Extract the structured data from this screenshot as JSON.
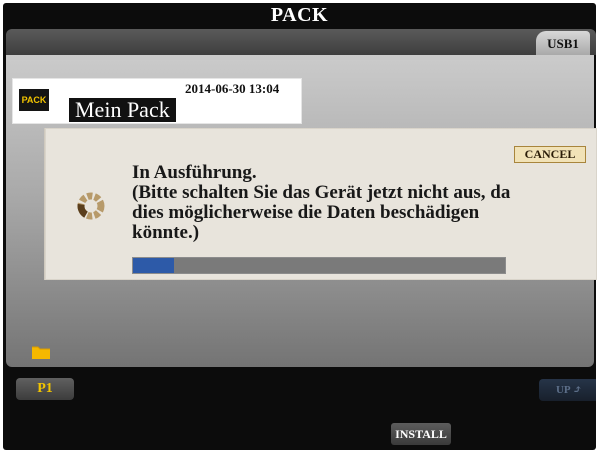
{
  "screen_title": "PACK",
  "tabs": {
    "device": "USB1"
  },
  "pack": {
    "logo_text": "PACK",
    "date": "2014-06-30 13:04",
    "name": "Mein Pack"
  },
  "dialog": {
    "cancel_label": "CANCEL",
    "message": "In Ausführung.\n(Bitte schalten Sie das Gerät jetzt nicht aus, da dies möglicherweise die Daten beschädigen könnte.)",
    "progress": 0.11
  },
  "footer": {
    "page_label": "P1",
    "up_label": "UP",
    "install_label": "INSTALL"
  },
  "icons": {
    "spinner": "loading-spinner-icon",
    "folder": "folder-icon",
    "up_arrow": "up-arrow-icon"
  },
  "colors": {
    "accent_yellow": "#f2c400",
    "progress_blue": "#2d5aa8"
  }
}
